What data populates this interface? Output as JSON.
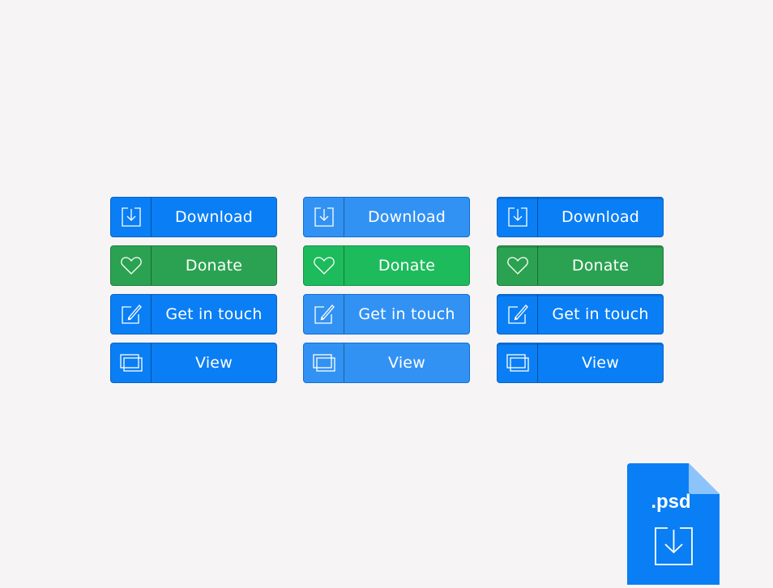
{
  "columns": [
    {
      "state": "normal",
      "buttons": [
        {
          "label": "Download",
          "icon": "download-icon"
        },
        {
          "label": "Donate",
          "icon": "heart-icon"
        },
        {
          "label": "Get in touch",
          "icon": "edit-icon"
        },
        {
          "label": "View",
          "icon": "windows-icon"
        }
      ]
    },
    {
      "state": "hover",
      "buttons": [
        {
          "label": "Download",
          "icon": "download-icon"
        },
        {
          "label": "Donate",
          "icon": "heart-icon"
        },
        {
          "label": "Get in touch",
          "icon": "edit-icon"
        },
        {
          "label": "View",
          "icon": "windows-icon"
        }
      ]
    },
    {
      "state": "pressed",
      "buttons": [
        {
          "label": "Download",
          "icon": "download-icon"
        },
        {
          "label": "Donate",
          "icon": "heart-icon"
        },
        {
          "label": "Get in touch",
          "icon": "edit-icon"
        },
        {
          "label": "View",
          "icon": "windows-icon"
        }
      ]
    }
  ],
  "badge": {
    "label": ".psd",
    "icon": "download-icon"
  },
  "colors": {
    "background": "#f6f4f5",
    "blue": "#0a7ef5",
    "light_blue": "#3292f3",
    "green": "#2ba251",
    "light_green": "#1dbb5c",
    "file_badge": "#0a7ef5"
  }
}
